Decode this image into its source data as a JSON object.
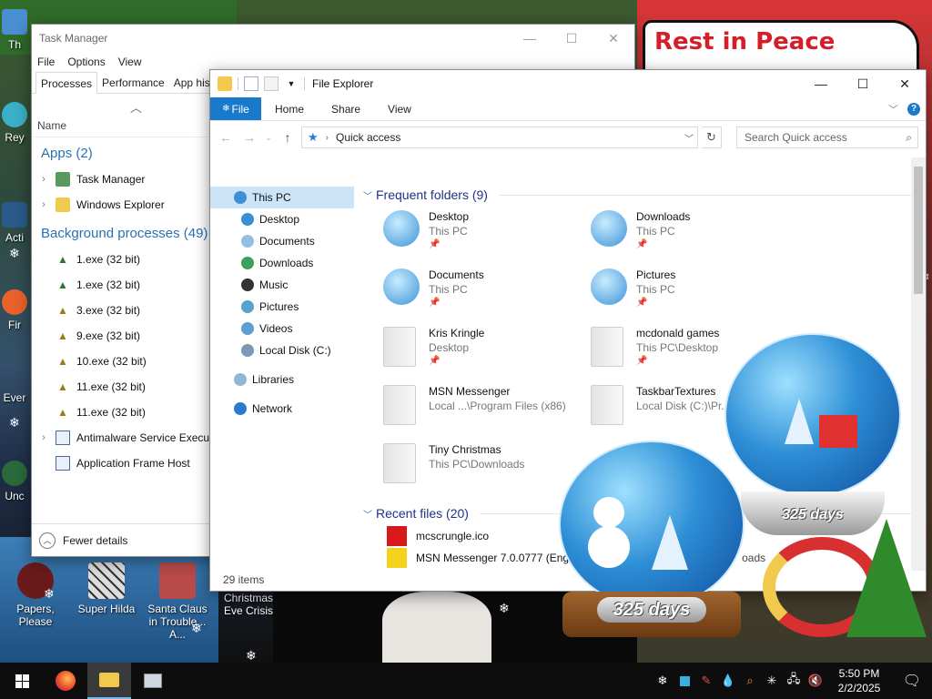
{
  "desktop": {
    "banner_text": "Rest in Peace",
    "icons": [
      {
        "label": "Papers, Please"
      },
      {
        "label": "Super Hilda"
      },
      {
        "label": "Santa Claus in Trouble... A..."
      },
      {
        "label": "Christmas Eve Crisis"
      }
    ],
    "partial_icon_labels": [
      "Th",
      "Rey",
      "Acti",
      "Fir",
      "Ever",
      "Unc"
    ],
    "globe_label_1": "325 days",
    "globe_label_2": "325 days"
  },
  "task_manager": {
    "title": "Task Manager",
    "menu": [
      "File",
      "Options",
      "View"
    ],
    "tabs": [
      "Processes",
      "Performance",
      "App history"
    ],
    "column_name": "Name",
    "apps_header": "Apps (2)",
    "apps": [
      {
        "name": "Task Manager",
        "icon": "task-manager-icon"
      },
      {
        "name": "Windows Explorer",
        "icon": "explorer-icon"
      }
    ],
    "bg_header": "Background processes (49)",
    "background": [
      {
        "name": "1.exe (32 bit)",
        "expand": false
      },
      {
        "name": "1.exe (32 bit)",
        "expand": false
      },
      {
        "name": "3.exe (32 bit)",
        "expand": false
      },
      {
        "name": "9.exe (32 bit)",
        "expand": false
      },
      {
        "name": "10.exe (32 bit)",
        "expand": false
      },
      {
        "name": "11.exe (32 bit)",
        "expand": false
      },
      {
        "name": "11.exe (32 bit)",
        "expand": false
      },
      {
        "name": "Antimalware Service Executable",
        "expand": true
      },
      {
        "name": "Application Frame Host",
        "expand": false
      }
    ],
    "fewer_details": "Fewer details"
  },
  "file_explorer": {
    "title": "File Explorer",
    "ribbon_tabs": [
      "File",
      "Home",
      "Share",
      "View"
    ],
    "address_location": "Quick access",
    "search_placeholder": "Search Quick access",
    "nav": [
      {
        "label": "This PC",
        "selected": true,
        "indent": 1,
        "color": "#3a8fd6"
      },
      {
        "label": "Desktop",
        "selected": false,
        "indent": 2,
        "color": "#3a8fd6"
      },
      {
        "label": "Documents",
        "selected": false,
        "indent": 2,
        "color": "#8fc0e0"
      },
      {
        "label": "Downloads",
        "selected": false,
        "indent": 2,
        "color": "#3aa05a"
      },
      {
        "label": "Music",
        "selected": false,
        "indent": 2,
        "color": "#333333"
      },
      {
        "label": "Pictures",
        "selected": false,
        "indent": 2,
        "color": "#5aa0d0"
      },
      {
        "label": "Videos",
        "selected": false,
        "indent": 2,
        "color": "#5aa0d0"
      },
      {
        "label": "Local Disk (C:)",
        "selected": false,
        "indent": 2,
        "color": "#7a9ab8"
      },
      {
        "label": "Libraries",
        "selected": false,
        "indent": 1,
        "color": "#8fb8d8"
      },
      {
        "label": "Network",
        "selected": false,
        "indent": 1,
        "color": "#2a7ad0"
      }
    ],
    "frequent_header": "Frequent folders (9)",
    "frequent": [
      {
        "name": "Desktop",
        "sub": "This PC",
        "style": "blue"
      },
      {
        "name": "Downloads",
        "sub": "This PC",
        "style": "blue"
      },
      {
        "name": "Documents",
        "sub": "This PC",
        "style": "blue"
      },
      {
        "name": "Pictures",
        "sub": "This PC",
        "style": "blue"
      },
      {
        "name": "Kris Kringle",
        "sub": "Desktop",
        "style": "plain"
      },
      {
        "name": "mcdonald games",
        "sub": "This PC\\Desktop",
        "style": "plain"
      },
      {
        "name": "MSN Messenger",
        "sub": "Local ...\\Program Files (x86)",
        "style": "plain"
      },
      {
        "name": "TaskbarTextures",
        "sub": "Local Disk (C:)\\Pr...",
        "style": "plain"
      },
      {
        "name": "Tiny Christmas",
        "sub": "This PC\\Downloads",
        "style": "plain"
      }
    ],
    "recent_header": "Recent files (20)",
    "recent": [
      {
        "name": "mcscrungle.ico",
        "color": "#d7191c"
      },
      {
        "name": "MSN Messenger 7.0.0777 (Eng",
        "color": "#f2d21b"
      }
    ],
    "recent_right_text": "oads",
    "status": "29 items"
  },
  "taskbar": {
    "time": "5:50 PM",
    "date": "2/2/2025"
  }
}
